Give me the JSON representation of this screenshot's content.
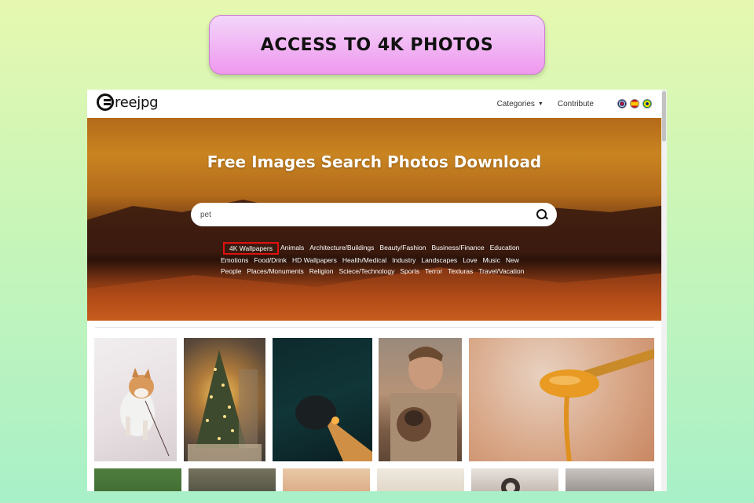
{
  "banner": {
    "title": "ACCESS TO 4K PHOTOS"
  },
  "site": {
    "logo_text": "reejpg",
    "nav": {
      "categories": "Categories",
      "contribute": "Contribute"
    },
    "flags": [
      "uk-flag-icon",
      "spain-flag-icon",
      "brazil-flag-icon"
    ]
  },
  "hero": {
    "title": "Free Images Search Photos Download",
    "search_value": "pet"
  },
  "categories": {
    "row1": [
      "4K Wallpapers",
      "Animals",
      "Architecture/Buildings",
      "Beauty/Fashion",
      "Business/Finance",
      "Education"
    ],
    "row2": [
      "Emotions",
      "Food/Drink",
      "HD Wallpapers",
      "Health/Medical",
      "Industry",
      "Landscapes",
      "Love",
      "Music",
      "New"
    ],
    "row3": [
      "People",
      "Places/Monuments",
      "Religion",
      "Sciece/Technology",
      "Sports",
      "Terror",
      "Texturas",
      "Travel/Vacation"
    ]
  },
  "colors": {
    "highlight": "#e31010",
    "banner_from": "#f3d6fa",
    "banner_to": "#ef98ee"
  }
}
